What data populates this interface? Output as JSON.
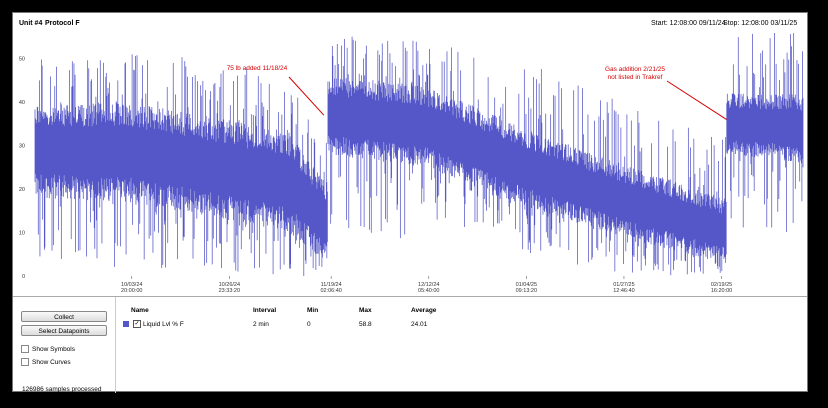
{
  "header": {
    "unit": "Unit #4",
    "protocol": "Protocol F",
    "start": "Start: 12:08:00  09/11/24",
    "stop": "Stop: 12:08:00  03/11/25"
  },
  "chart_data": {
    "type": "line",
    "title": "",
    "xlabel": "",
    "ylabel": "",
    "ylim": [
      0,
      55
    ],
    "y_ticks": [
      0,
      10,
      20,
      30,
      40,
      50
    ],
    "x_ticks": [
      {
        "date": "10/03/24",
        "time": "20:00:00"
      },
      {
        "date": "10/26/24",
        "time": "23:33:20"
      },
      {
        "date": "11/19/24",
        "time": "02:06:40"
      },
      {
        "date": "12/12/24",
        "time": "05:40:00"
      },
      {
        "date": "01/04/25",
        "time": "09:13:20"
      },
      {
        "date": "01/27/25",
        "time": "12:46:40"
      },
      {
        "date": "02/19/25",
        "time": "16:20:00"
      }
    ],
    "color": "#5557c8",
    "series": [
      {
        "name": "Liquid Lvl % F",
        "envelope": [
          {
            "x": "09/11/24",
            "lo": 2,
            "base_lo": 18,
            "base_hi": 40,
            "hi": 52
          },
          {
            "x": "10/03/24",
            "lo": 2,
            "base_lo": 17,
            "base_hi": 40,
            "hi": 52
          },
          {
            "x": "10/26/24",
            "lo": 1,
            "base_lo": 13,
            "base_hi": 36,
            "hi": 50
          },
          {
            "x": "11/10/24",
            "lo": 0,
            "base_lo": 10,
            "base_hi": 33,
            "hi": 45
          },
          {
            "x": "11/18/24",
            "lo": 0,
            "base_lo": 4,
            "base_hi": 22,
            "hi": 32
          },
          {
            "x": "11/19/24",
            "lo": 10,
            "base_lo": 28,
            "base_hi": 46,
            "hi": 56
          },
          {
            "x": "12/12/24",
            "lo": 8,
            "base_lo": 25,
            "base_hi": 44,
            "hi": 54
          },
          {
            "x": "01/04/25",
            "lo": 5,
            "base_lo": 16,
            "base_hi": 34,
            "hi": 50
          },
          {
            "x": "01/27/25",
            "lo": 0,
            "base_lo": 9,
            "base_hi": 26,
            "hi": 40
          },
          {
            "x": "02/20/25",
            "lo": 0,
            "base_lo": 3,
            "base_hi": 18,
            "hi": 32
          },
          {
            "x": "02/21/25",
            "lo": 10,
            "base_lo": 28,
            "base_hi": 42,
            "hi": 58
          },
          {
            "x": "03/11/25",
            "lo": 10,
            "base_lo": 26,
            "base_hi": 42,
            "hi": 57
          }
        ]
      }
    ],
    "annotations": [
      {
        "text": "75 lb added 11/18/24",
        "x": "11/18/24",
        "y": 37
      },
      {
        "text": "Gas addition 2/21/25",
        "text2": "not listed in Trakref",
        "x": "02/21/25",
        "y": 36
      }
    ]
  },
  "controls": {
    "collect": "Collect",
    "select_datapoints": "Select Datapoints",
    "show_symbols": "Show Symbols",
    "show_curves": "Show Curves",
    "samples": "126986 samples processed"
  },
  "table": {
    "headers": {
      "name": "Name",
      "interval": "Interval",
      "min": "Min",
      "max": "Max",
      "average": "Average"
    },
    "row": {
      "name": "Liquid Lvl % F",
      "interval": "2 min",
      "min": "0",
      "max": "58.8",
      "average": "24.01"
    }
  }
}
